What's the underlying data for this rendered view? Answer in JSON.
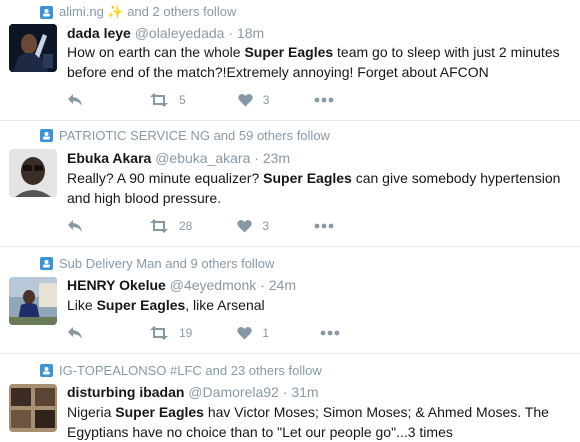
{
  "tweets": [
    {
      "context": "alimi.ng ✨ and 2 others follow",
      "name": "dada leye",
      "handle": "@olaleyedada",
      "time": "18m",
      "text_pre": "How on earth can the whole ",
      "text_bold": "Super Eagles",
      "text_post": " team go to sleep with just 2 minutes before end of the match?!Extremely annoying! Forget about AFCON",
      "retweets": "5",
      "likes": "3"
    },
    {
      "context": "PATRIOTIC SERVICE NG and 59 others follow",
      "name": "Ebuka Akara",
      "handle": "@ebuka_akara",
      "time": "23m",
      "text_pre": "Really? A 90 minute equalizer? ",
      "text_bold": "Super Eagles",
      "text_post": " can give somebody hypertension and high blood pressure.",
      "retweets": "28",
      "likes": "3"
    },
    {
      "context": "Sub Delivery Man and 9 others follow",
      "name": "HENRY Okelue",
      "handle": "@4eyedmonk",
      "time": "24m",
      "text_pre": "Like ",
      "text_bold": "Super Eagles",
      "text_post": ", like Arsenal",
      "retweets": "19",
      "likes": "1"
    },
    {
      "context": "IG-TOPEALONSO #LFC and 23 others follow",
      "name": "disturbing ibadan",
      "handle": "@Damorela92",
      "time": "31m",
      "text_pre": "Nigeria ",
      "text_bold": "Super Eagles",
      "text_post": " hav Victor Moses; Simon Moses; & Ahmed Moses. The Egyptians have no choice than to \"Let our people go\"...3 times",
      "retweets": "",
      "likes": ""
    }
  ],
  "separator": "·"
}
